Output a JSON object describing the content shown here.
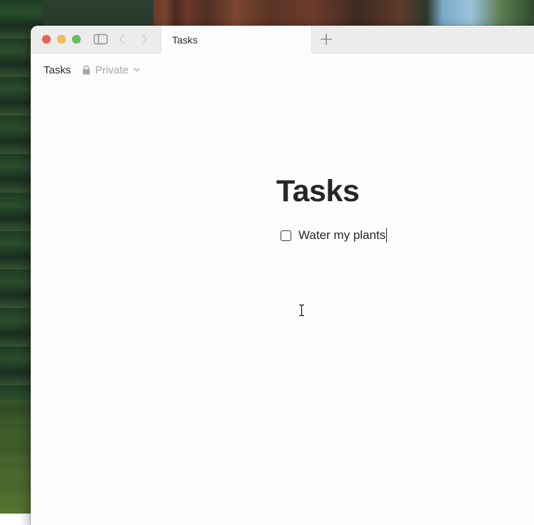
{
  "window": {
    "tab_title": "Tasks",
    "breadcrumb_title": "Tasks",
    "privacy_label": "Private"
  },
  "page": {
    "title": "Tasks",
    "tasks": [
      {
        "text": "Water my plants",
        "checked": false
      }
    ]
  },
  "icons": {
    "sidebar": "sidebar-icon",
    "back": "chevron-left-icon",
    "forward": "chevron-right-icon",
    "new_tab": "plus-icon",
    "lock": "lock-icon",
    "dropdown": "chevron-down-icon",
    "cursor": "text-cursor-icon"
  },
  "colors": {
    "close": "#ee5e57",
    "minimize": "#f5bd4f",
    "maximize": "#5fc454"
  }
}
